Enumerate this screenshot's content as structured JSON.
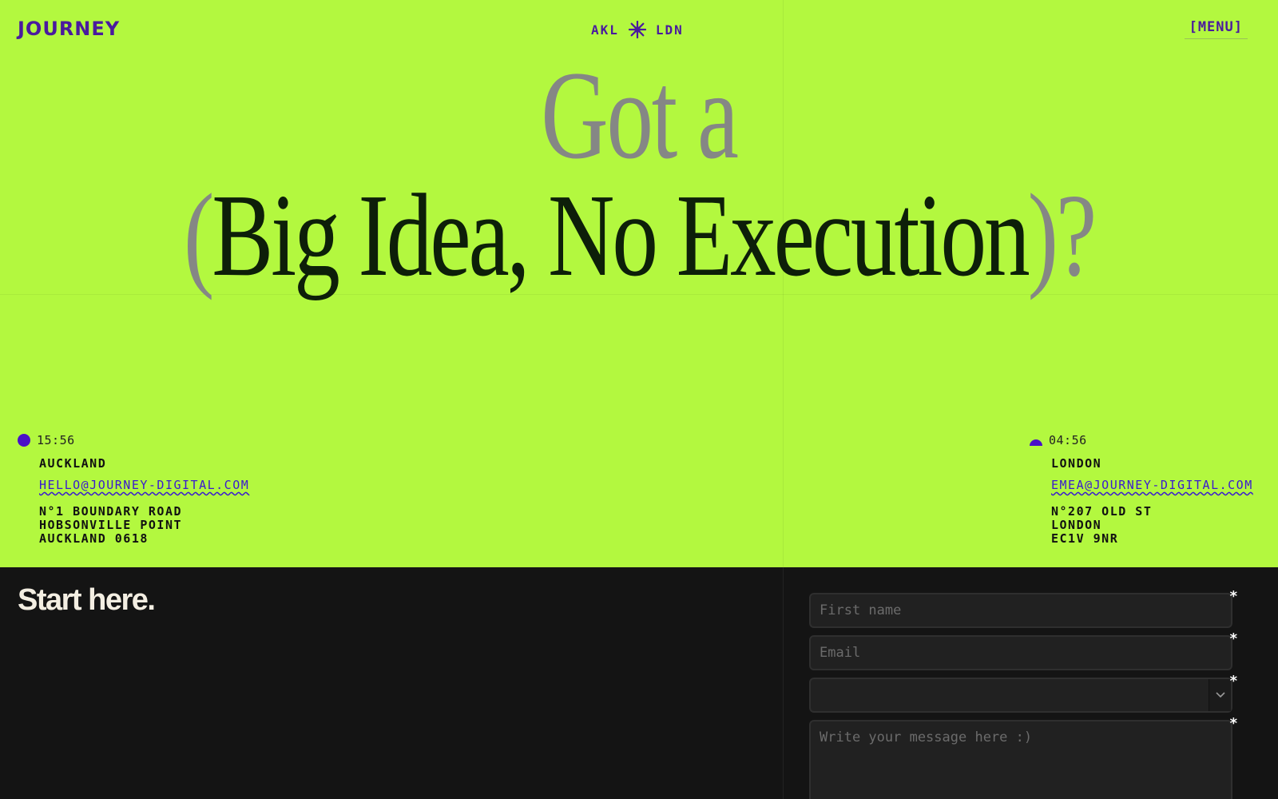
{
  "header": {
    "logo": "JOURNEY",
    "city_left": "AKL",
    "city_right": "LDN",
    "menu_label": "[MENU]"
  },
  "hero": {
    "line1": "Got a",
    "open_paren": "(",
    "emphasis": "Big Idea, No Execution",
    "close_paren": ")?"
  },
  "locations": [
    {
      "time": "15:56",
      "city": "AUCKLAND",
      "email": "HELLO@JOURNEY-DIGITAL.COM",
      "address": [
        "N°1 BOUNDARY ROAD",
        "HOBSONVILLE POINT",
        "AUCKLAND 0618"
      ]
    },
    {
      "time": "04:56",
      "city": "LONDON",
      "email": "EMEA@JOURNEY-DIGITAL.COM",
      "address": [
        "N°207 OLD ST",
        "LONDON",
        "EC1V 9NR"
      ]
    }
  ],
  "contact": {
    "heading": "Start here.",
    "first_name_placeholder": "First name",
    "email_placeholder": "Email",
    "select_value": "",
    "message_placeholder": "Write your message here :)",
    "required_marker": "*"
  },
  "colors": {
    "accent_bg": "#b3f83f",
    "brand_purple": "#4a1a9e",
    "dark_bg": "#141414"
  },
  "icons": {
    "divider": "star-burst-icon",
    "day": "full-circle-icon",
    "night": "half-circle-icon",
    "select": "chevron-down-icon"
  }
}
